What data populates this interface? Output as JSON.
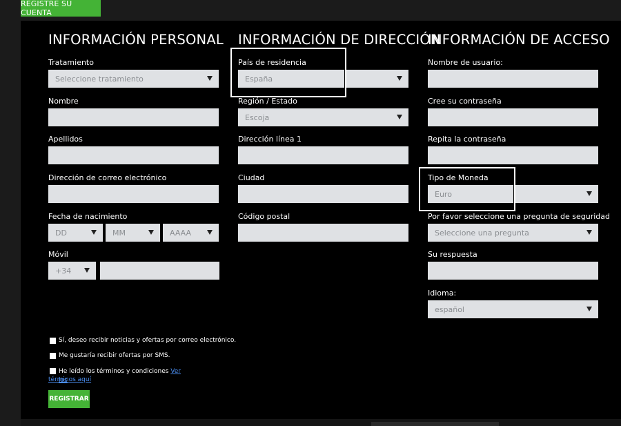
{
  "top_tab": {
    "label": "REGISTRE SU CUENTA"
  },
  "personal": {
    "title": "INFORMACIÓN PERSONAL",
    "treatment": {
      "label": "Tratamiento",
      "value": "Seleccione tratamiento"
    },
    "first_name": {
      "label": "Nombre",
      "value": ""
    },
    "last_name": {
      "label": "Apellidos",
      "value": ""
    },
    "email": {
      "label": "Dirección de correo electrónico",
      "value": ""
    },
    "birth": {
      "label": "Fecha de nacimiento",
      "day": "DD",
      "month": "MM",
      "year": "AAAA"
    },
    "mobile": {
      "label": "Móvil",
      "prefix": "+34",
      "value": ""
    }
  },
  "address": {
    "title": "INFORMACIÓN DE DIRECCIÓN",
    "country": {
      "label": "País de residencia",
      "value": "España"
    },
    "region": {
      "label": "Región / Estado",
      "value": "Escoja"
    },
    "address1": {
      "label": "Dirección línea 1",
      "value": ""
    },
    "city": {
      "label": "Ciudad",
      "value": ""
    },
    "postal": {
      "label": "Código postal",
      "value": ""
    }
  },
  "access": {
    "title": "INFORMACIÓN DE ACCESO",
    "username": {
      "label": "Nombre de usuario:",
      "value": ""
    },
    "password": {
      "label": "Cree su contraseña",
      "value": ""
    },
    "password_repeat": {
      "label": "Repita la contraseña",
      "value": ""
    },
    "currency": {
      "label": "Tipo de Moneda",
      "value": "Euro"
    },
    "security_question": {
      "label": "Por favor seleccione una pregunta de seguridad",
      "value": "Seleccione una pregunta"
    },
    "answer": {
      "label": "Su respuesta",
      "value": ""
    },
    "language": {
      "label": "Idioma:",
      "value": "español"
    }
  },
  "consents": {
    "news": "Sí, deseo recibir noticias y ofertas por correo electrónico.",
    "sms": "Me gustaría recibir ofertas por SMS.",
    "terms_text": "He leído los términos y condiciones ",
    "terms_link_1": "Ver los",
    "terms_link_2": "términos aquí"
  },
  "submit": {
    "label": "REGISTRAR"
  },
  "colors": {
    "accent_green": "#44b336",
    "panel": "#000000",
    "field": "#dfe1e4",
    "link": "#4b8ef0"
  }
}
